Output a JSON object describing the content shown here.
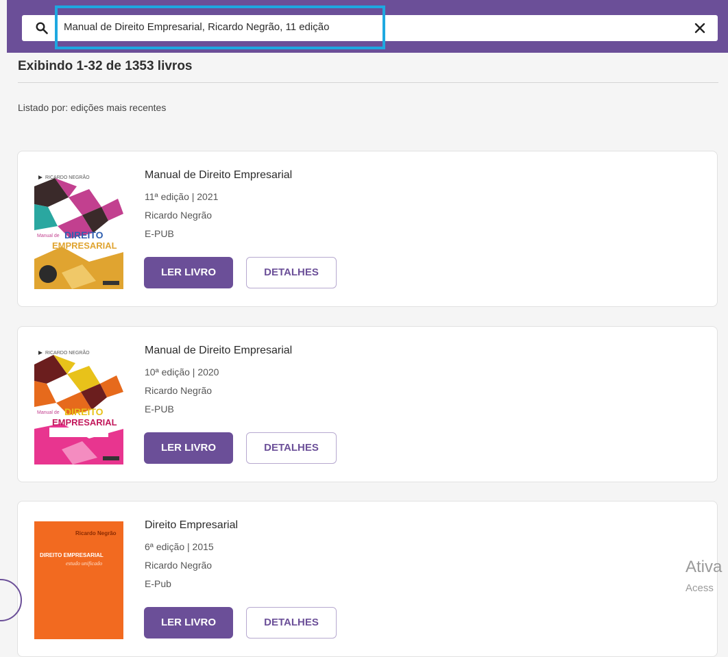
{
  "search": {
    "query": "Manual de Direito Empresarial, Ricardo Negrão, 11 edição"
  },
  "results": {
    "count_text": "Exibindo 1-32 de 1353 livros",
    "sort_text": "Listado por: edições mais recentes"
  },
  "books": [
    {
      "title": "Manual de Direito Empresarial",
      "edition": "11ª edição | 2021",
      "author": "Ricardo Negrão",
      "format": "E-PUB",
      "read_label": "LER LIVRO",
      "details_label": "DETALHES",
      "cover": {
        "author": "RICARDO NEGRÃO",
        "pre": "Manual de",
        "line1": "DIREITO",
        "line2": "EMPRESARIAL",
        "colors": [
          "#3a2a2a",
          "#c2408f",
          "#2aa7a0",
          "#e0a430"
        ]
      }
    },
    {
      "title": "Manual de Direito Empresarial",
      "edition": "10ª edição | 2020",
      "author": "Ricardo Negrão",
      "format": "E-PUB",
      "read_label": "LER LIVRO",
      "details_label": "DETALHES",
      "cover": {
        "author": "RICARDO NEGRÃO",
        "pre": "Manual de",
        "line1": "DIREITO",
        "line2": "EMPRESARIAL",
        "colors": [
          "#6b1e1e",
          "#e8c21a",
          "#e66a1c",
          "#e8358f"
        ]
      }
    },
    {
      "title": "Direito Empresarial",
      "edition": "6ª edição | 2015",
      "author": "Ricardo Negrão",
      "format": "E-Pub",
      "read_label": "LER LIVRO",
      "details_label": "DETALHES",
      "cover": {
        "author": "Ricardo Negrão",
        "line1": "DIREITO EMPRESARIAL",
        "line2": "estudo unificado",
        "colors": [
          "#f26a20"
        ]
      }
    }
  ],
  "watermark": {
    "line1": "Ativa",
    "line2": "Acess"
  },
  "colors": {
    "brand": "#6b4f98",
    "highlight": "#1ea8e0"
  }
}
